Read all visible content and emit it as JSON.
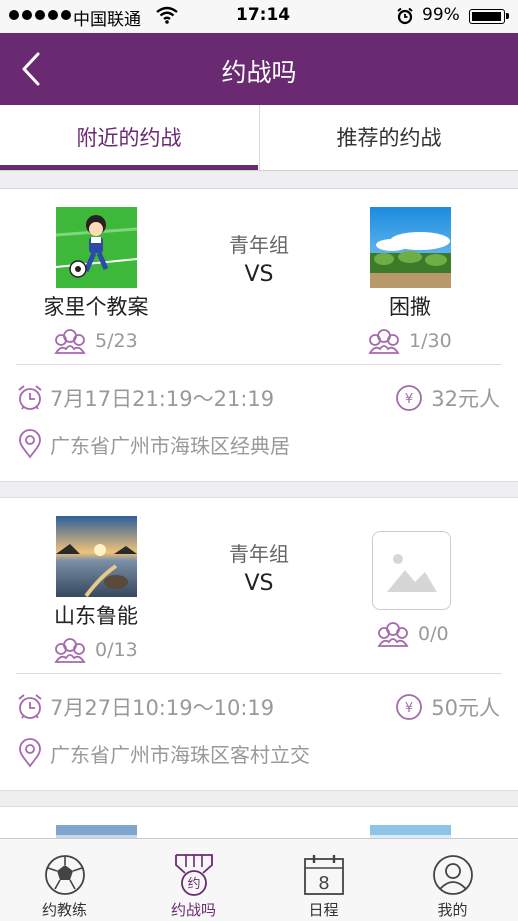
{
  "status_bar": {
    "carrier": "中国联通",
    "time": "17:14",
    "battery": "99%"
  },
  "nav": {
    "title": "约战吗"
  },
  "tabs": [
    {
      "label": "附近的约战",
      "active": true
    },
    {
      "label": "推荐的约战",
      "active": false
    }
  ],
  "matches": [
    {
      "group": "青年组",
      "vs": "VS",
      "home": {
        "name": "家里个教案",
        "count": "5/23"
      },
      "away": {
        "name": "困撒",
        "count": "1/30"
      },
      "time": "7月17日21:19～21:19",
      "price": "32元人",
      "address": "广东省广州市海珠区经典居"
    },
    {
      "group": "青年组",
      "vs": "VS",
      "home": {
        "name": "山东鲁能",
        "count": "0/13"
      },
      "away": {
        "name": "",
        "count": "0/0"
      },
      "time": "7月27日10:19～10:19",
      "price": "50元人",
      "address": "广东省广州市海珠区客村立交"
    }
  ],
  "tabbar": [
    {
      "label": "约教练",
      "icon": "soccer-ball-icon"
    },
    {
      "label": "约战吗",
      "icon": "medal-icon",
      "active": true,
      "icon_text": "约"
    },
    {
      "label": "日程",
      "icon": "calendar-icon",
      "icon_text": "8"
    },
    {
      "label": "我的",
      "icon": "user-icon"
    }
  ],
  "colors": {
    "brand": "#6a2a72",
    "muted": "#999999"
  }
}
